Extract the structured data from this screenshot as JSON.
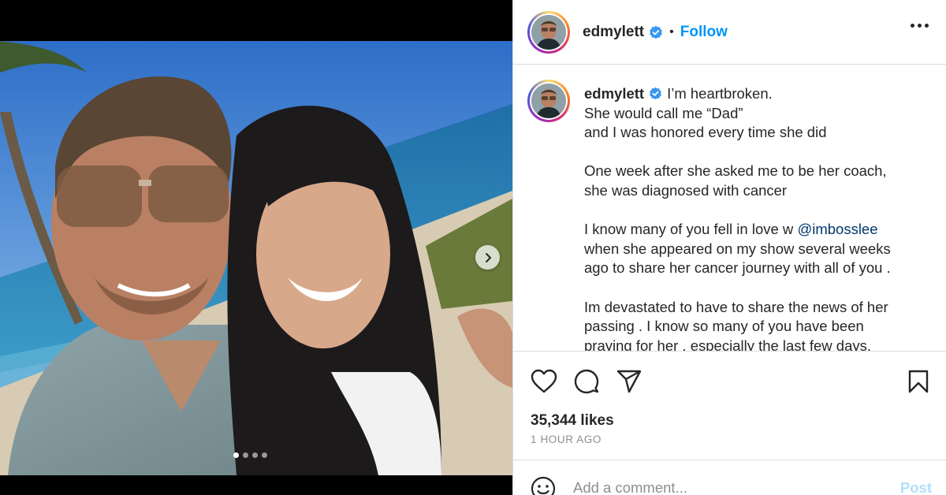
{
  "post": {
    "username": "edmylett",
    "follow_label": "Follow",
    "separator": "•",
    "carousel": {
      "slide_count": 4,
      "active_index": 0
    },
    "caption": {
      "username": "edmylett",
      "lines": [
        "I’m heartbroken.",
        "She would call me “Dad”",
        "and I was honored every time she did",
        "",
        "One week after she asked me to be her coach,",
        "she was diagnosed with cancer",
        "",
        "I know many of you fell in love w ",
        "when she appeared on my show several weeks",
        "ago to share her cancer journey with all of you .",
        "",
        "Im devastated to have to share the news of her",
        "passing . I know so many of you have been",
        "praying for her , especially the last few days."
      ],
      "mention": "@imbosslee"
    },
    "likes": "35,344 likes",
    "timestamp": "1 HOUR AGO",
    "comment": {
      "placeholder": "Add a comment...",
      "post_label": "Post"
    }
  },
  "icons": {
    "verified": "verified-badge-icon",
    "more": "more-options-icon",
    "like": "heart-icon",
    "comment": "comment-icon",
    "share": "share-icon",
    "save": "bookmark-icon",
    "emoji": "emoji-icon",
    "next": "chevron-right-icon"
  },
  "colors": {
    "link_blue": "#0095f6",
    "verified_blue": "#3897f0",
    "mention_blue": "#00376b",
    "muted": "#8e8e8e",
    "post_disabled": "#b2dffc"
  }
}
